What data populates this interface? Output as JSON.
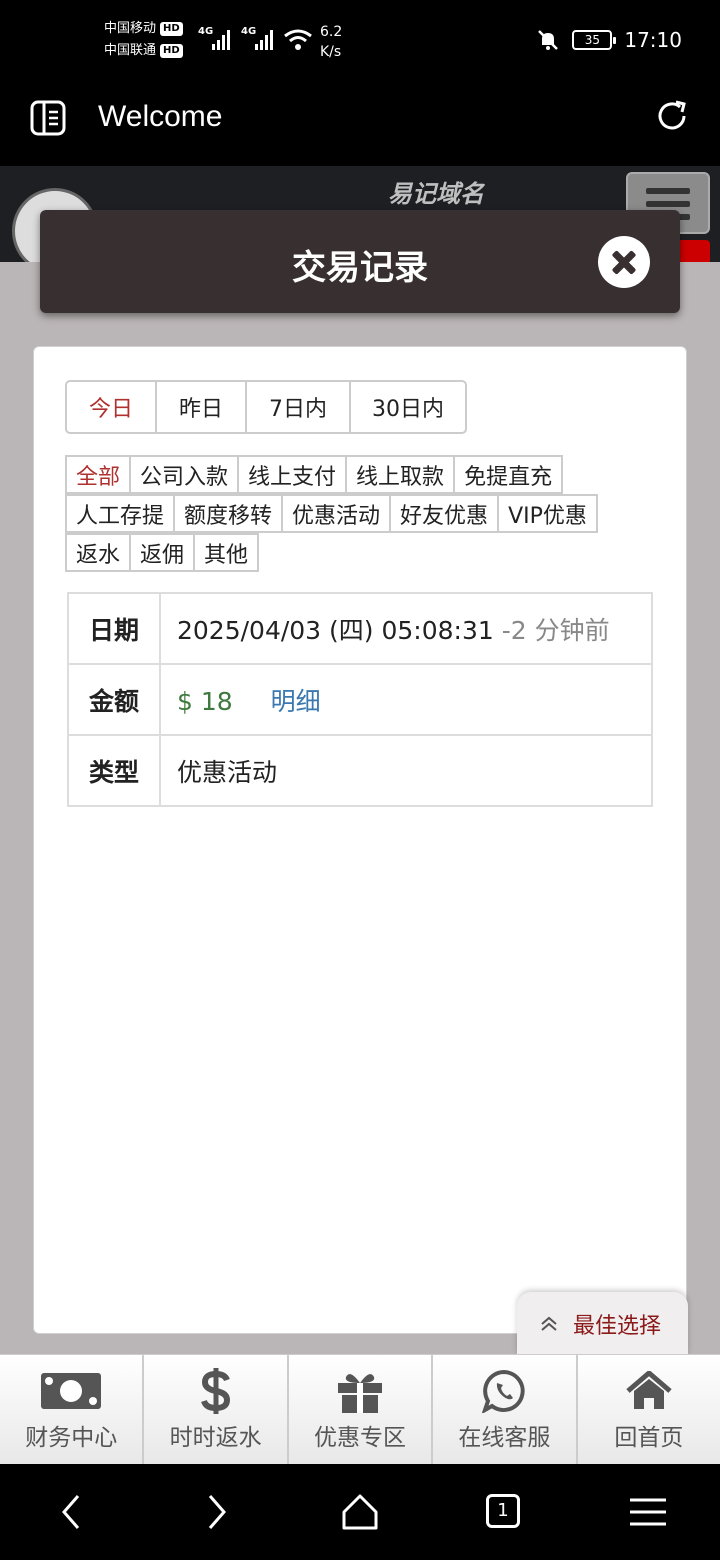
{
  "status_bar": {
    "carrier1": "中国移动",
    "carrier2": "中国联通",
    "hd": "HD",
    "net1": "4G",
    "net2": "4G",
    "speed_value": "6.2",
    "speed_unit": "K/s",
    "battery": "35",
    "time": "17:10"
  },
  "browser": {
    "title": "Welcome"
  },
  "site": {
    "brand_text": "易记域名"
  },
  "modal": {
    "title": "交易记录"
  },
  "date_tabs": [
    {
      "label": "今日",
      "active": true
    },
    {
      "label": "昨日",
      "active": false
    },
    {
      "label": "7日内",
      "active": false
    },
    {
      "label": "30日内",
      "active": false
    }
  ],
  "categories": [
    {
      "label": "全部",
      "active": true
    },
    {
      "label": "公司入款"
    },
    {
      "label": "线上支付"
    },
    {
      "label": "线上取款"
    },
    {
      "label": "免提直充"
    },
    {
      "label": "人工存提"
    },
    {
      "label": "额度移转"
    },
    {
      "label": "优惠活动"
    },
    {
      "label": "好友优惠"
    },
    {
      "label": "VIP优惠"
    },
    {
      "label": "返水"
    },
    {
      "label": "返佣"
    },
    {
      "label": "其他"
    }
  ],
  "record": {
    "date_label": "日期",
    "date_value": "2025/04/03 (四) 05:08:31",
    "date_ago": "-2 分钟前",
    "amount_label": "金额",
    "amount_value": "$ 18",
    "detail_link": "明细",
    "type_label": "类型",
    "type_value": "优惠活动"
  },
  "best_choice": {
    "label": "最佳选择"
  },
  "bottom_nav": [
    {
      "label": "财务中心",
      "icon": "money-icon"
    },
    {
      "label": "时时返水",
      "icon": "dollar-icon"
    },
    {
      "label": "优惠专区",
      "icon": "gift-icon"
    },
    {
      "label": "在线客服",
      "icon": "chat-icon"
    },
    {
      "label": "回首页",
      "icon": "home-icon"
    }
  ],
  "system_nav": {
    "tab_count": "1"
  },
  "colors": {
    "modal_header": "#382f31",
    "active_red": "#b03030",
    "amount_green": "#3e7a3e",
    "link_blue": "#3a78b0",
    "best_label": "#8b1a1a"
  }
}
